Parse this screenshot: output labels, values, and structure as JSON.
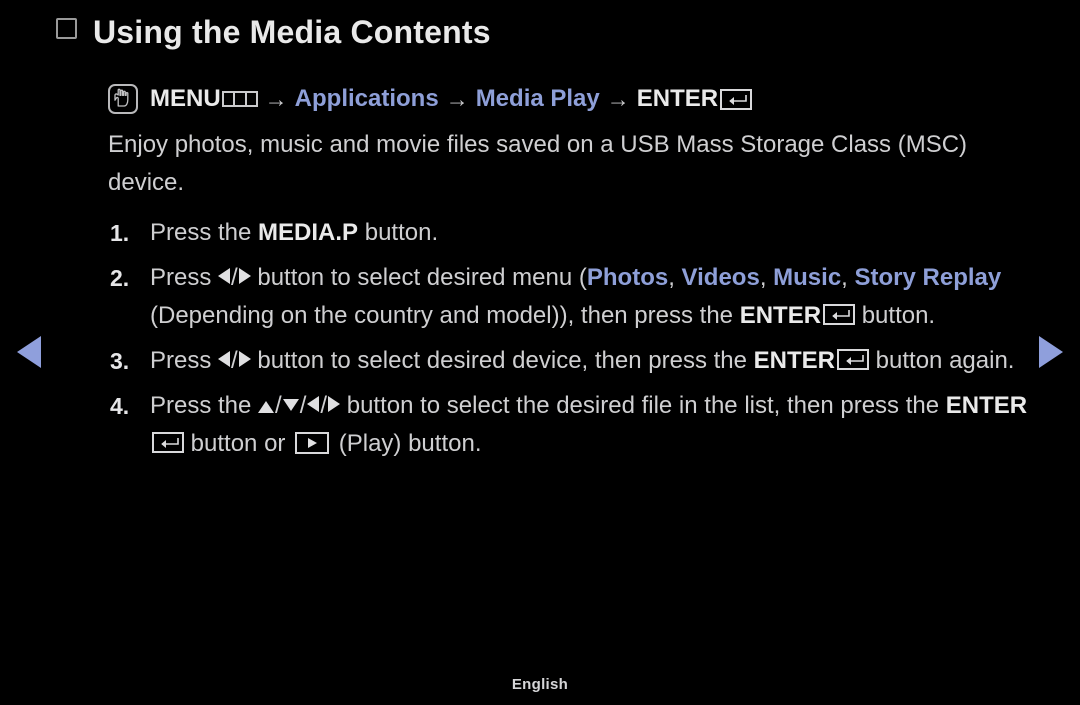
{
  "page": {
    "background_color": "#000000",
    "text_color": "#cfcfd1",
    "accent_color": "#8e9fd8",
    "footer_language": "English"
  },
  "title": {
    "text": "Using the Media Contents",
    "bullet_icon": "square-bullet-icon"
  },
  "menu_path": {
    "touch_icon": "touch-hand-icon",
    "menu_label": "MENU",
    "menu_bars_icon": "menu-bars-icon",
    "arrow": "→",
    "applications_label": "Applications",
    "media_play_label": "Media Play",
    "enter_label": "ENTER",
    "enter_icon": "enter-return-icon"
  },
  "intro": {
    "text": "Enjoy photos, music and movie files saved on a USB Mass Storage Class (MSC) device."
  },
  "steps": [
    {
      "number": "1.",
      "parts": {
        "pre": "Press the ",
        "button": "MEDIA.P",
        "post": " button."
      }
    },
    {
      "number": "2.",
      "parts": {
        "pre": "Press ",
        "mid": " button to select desired menu (",
        "menu_1": "Photos",
        "sep_1": ", ",
        "menu_2": "Videos",
        "sep_2": ", ",
        "menu_3": "Music",
        "sep_3": ", ",
        "menu_4": "Story Replay",
        "tail": " (Depending on the country and model)), then press the ",
        "enter": "ENTER",
        "end": " button."
      }
    },
    {
      "number": "3.",
      "parts": {
        "pre": "Press ",
        "mid": " button to select desired device, then press the ",
        "enter": "ENTER",
        "end": " button again."
      }
    },
    {
      "number": "4.",
      "parts": {
        "pre": "Press the ",
        "mid": " button to select the desired file in the list, then press the ",
        "enter": "ENTER",
        "mid2": " button or ",
        "end": " (Play) button."
      }
    }
  ],
  "navigation": {
    "prev_icon": "prev-page-arrow-icon",
    "next_icon": "next-page-arrow-icon"
  }
}
